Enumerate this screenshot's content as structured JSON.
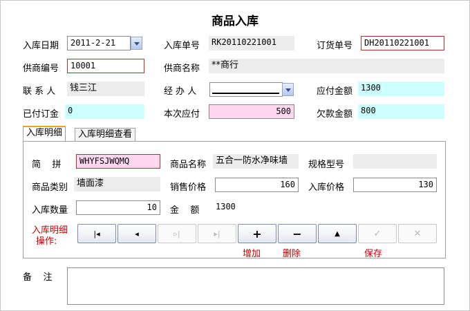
{
  "window": {
    "title": "商品入库"
  },
  "header": {
    "date_label": "入库日期",
    "date_value": "2011-2-21",
    "receipt_no_label": "入库单号",
    "receipt_no_value": "RK20110221001",
    "order_no_label": "订货单号",
    "order_no_value": "DH20110221001",
    "supplier_code_label": "供商编号",
    "supplier_code_value": "10001",
    "supplier_name_label": "供商名称",
    "supplier_name_value": "**商行",
    "contact_label": "联 系 人",
    "contact_value": "钱三江",
    "handler_label": "经 办 人",
    "handler_value": "",
    "payable_label": "应付金额",
    "payable_value": "1300",
    "prepaid_label": "已付订金",
    "prepaid_value": "0",
    "current_pay_label": "本次应付",
    "current_pay_value": "500",
    "owed_label": "欠款金额",
    "owed_value": "800"
  },
  "tabs": [
    {
      "label": "入库明细"
    },
    {
      "label": "入库明细查看"
    }
  ],
  "detail": {
    "pinyin_label": "简    拼",
    "pinyin_value": "WHYFSJWQMQ",
    "product_name_label": "商品名称",
    "product_name_value": "五合一防水净味墙",
    "spec_label": "规格型号",
    "spec_value": "",
    "category_label": "商品类别",
    "category_value": "墙面漆",
    "sale_price_label": "销售价格",
    "sale_price_value": "160",
    "in_price_label": "入库价格",
    "in_price_value": "130",
    "qty_label": "入库数量",
    "qty_value": "10",
    "amount_label": "金    额",
    "amount_value": "1300",
    "ops_label_line1": "入库明细",
    "ops_label_line2": "操作:"
  },
  "nav": {
    "first": "|◂",
    "prev": "◂",
    "next": "▹|",
    "last": "▸|",
    "add": "+",
    "delete": "−",
    "up": "▲",
    "save": "✓",
    "cancel": "✕",
    "add_caption": "增加",
    "delete_caption": "删除",
    "save_caption": "保存"
  },
  "remarks": {
    "label": "备    注",
    "value": ""
  }
}
